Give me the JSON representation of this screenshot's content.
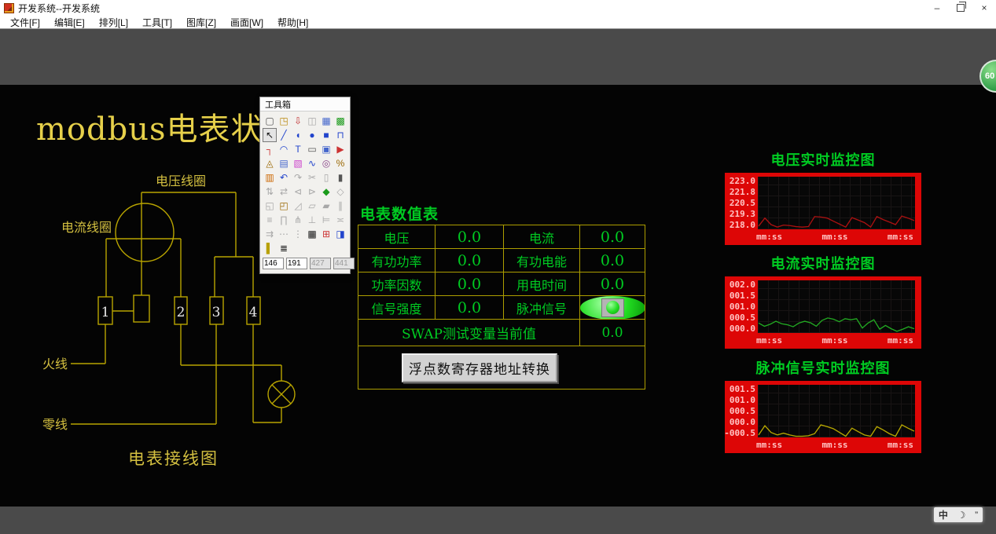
{
  "window": {
    "title": "开发系统--开发系统",
    "minimize": "–",
    "close": "×"
  },
  "menu": {
    "items": [
      {
        "id": "file",
        "label": "文件[F]"
      },
      {
        "id": "edit",
        "label": "编辑[E]"
      },
      {
        "id": "arrange",
        "label": "排列[L]"
      },
      {
        "id": "tools",
        "label": "工具[T]"
      },
      {
        "id": "gallery",
        "label": "图库[Z]"
      },
      {
        "id": "screen",
        "label": "画面[W]"
      },
      {
        "id": "help",
        "label": "帮助[H]"
      }
    ]
  },
  "page": {
    "title": "modbus电表状态"
  },
  "toolbox": {
    "title": "工具箱",
    "icons": [
      {
        "n": "new-file",
        "g": "▢",
        "c": "#555",
        "e": 1
      },
      {
        "n": "open-file",
        "g": "◳",
        "c": "#b8860b",
        "e": 1
      },
      {
        "n": "import",
        "g": "⇩",
        "c": "#c03030",
        "e": 1
      },
      {
        "n": "save",
        "g": "◫",
        "c": "#999",
        "e": 0
      },
      {
        "n": "preview",
        "g": "▦",
        "c": "#4466cc",
        "e": 1
      },
      {
        "n": "run",
        "g": "▩",
        "c": "#1a9a1a",
        "e": 1
      },
      {
        "n": "select",
        "g": "↖",
        "c": "#111",
        "e": 1,
        "a": 1
      },
      {
        "n": "line-tool",
        "g": "╱",
        "c": "#2244cc",
        "e": 1
      },
      {
        "n": "ellipse-tool",
        "g": "◖",
        "c": "#2244cc",
        "e": 1
      },
      {
        "n": "circle-tool",
        "g": "●",
        "c": "#2244cc",
        "e": 1
      },
      {
        "n": "rectangle-tool",
        "g": "■",
        "c": "#2244cc",
        "e": 1
      },
      {
        "n": "polyline-tool",
        "g": "⊓",
        "c": "#2244cc",
        "e": 1
      },
      {
        "n": "pipe-tool",
        "g": "┐",
        "c": "#cc3333",
        "e": 1
      },
      {
        "n": "arc-tool",
        "g": "◠",
        "c": "#2244cc",
        "e": 1
      },
      {
        "n": "text-tool",
        "g": "T",
        "c": "#2244cc",
        "e": 1
      },
      {
        "n": "rounded-rect-tool",
        "g": "▭",
        "c": "#555",
        "e": 1
      },
      {
        "n": "bitmap-tool",
        "g": "▣",
        "c": "#4466cc",
        "e": 1
      },
      {
        "n": "animation-tool",
        "g": "▶",
        "c": "#cc3333",
        "e": 1
      },
      {
        "n": "alarm-tool",
        "g": "◬",
        "c": "#996600",
        "e": 1
      },
      {
        "n": "report-tool",
        "g": "▤",
        "c": "#4466cc",
        "e": 1
      },
      {
        "n": "gif-tool",
        "g": "▧",
        "c": "#cc44cc",
        "e": 1
      },
      {
        "n": "trend-tool",
        "g": "∿",
        "c": "#2244cc",
        "e": 1
      },
      {
        "n": "ole-tool",
        "g": "◎",
        "c": "#884488",
        "e": 1
      },
      {
        "n": "scale-tool",
        "g": "%",
        "c": "#996600",
        "e": 1
      },
      {
        "n": "multi-state",
        "g": "▥",
        "c": "#cc6600",
        "e": 1
      },
      {
        "n": "undo",
        "g": "↶",
        "c": "#2244cc",
        "e": 1
      },
      {
        "n": "redo",
        "g": "↷",
        "c": "#999",
        "e": 0
      },
      {
        "n": "cut",
        "g": "✂",
        "c": "#999",
        "e": 0
      },
      {
        "n": "copy",
        "g": "▯",
        "c": "#999",
        "e": 0
      },
      {
        "n": "paste",
        "g": "▮",
        "c": "#555",
        "e": 1
      },
      {
        "n": "flip-vertical",
        "g": "⇅",
        "c": "#999",
        "e": 0
      },
      {
        "n": "flip-horizontal",
        "g": "⇄",
        "c": "#999",
        "e": 0
      },
      {
        "n": "rotate-left",
        "g": "⊲",
        "c": "#999",
        "e": 0
      },
      {
        "n": "rotate-right",
        "g": "⊳",
        "c": "#999",
        "e": 0
      },
      {
        "n": "group",
        "g": "◆",
        "c": "#1a9a1a",
        "e": 1
      },
      {
        "n": "ungroup",
        "g": "◇",
        "c": "#999",
        "e": 0
      },
      {
        "n": "bring-front",
        "g": "◱",
        "c": "#999",
        "e": 0
      },
      {
        "n": "send-back",
        "g": "◰",
        "c": "#996600",
        "e": 1
      },
      {
        "n": "skew",
        "g": "◿",
        "c": "#999",
        "e": 0
      },
      {
        "n": "node-edit",
        "g": "▱",
        "c": "#999",
        "e": 0
      },
      {
        "n": "copy-style",
        "g": "▰",
        "c": "#999",
        "e": 0
      },
      {
        "n": "same-size",
        "g": "∥",
        "c": "#999",
        "e": 0
      },
      {
        "n": "align-left",
        "g": "≡",
        "c": "#999",
        "e": 0
      },
      {
        "n": "align-top",
        "g": "∏",
        "c": "#999",
        "e": 0
      },
      {
        "n": "align-center",
        "g": "⋔",
        "c": "#999",
        "e": 0
      },
      {
        "n": "align-bottom",
        "g": "⊥",
        "c": "#999",
        "e": 0
      },
      {
        "n": "align-right",
        "g": "⊨",
        "c": "#999",
        "e": 0
      },
      {
        "n": "align-middle",
        "g": "≍",
        "c": "#999",
        "e": 0
      },
      {
        "n": "space-horizontal",
        "g": "⇉",
        "c": "#999",
        "e": 0
      },
      {
        "n": "space-dots",
        "g": "⋯",
        "c": "#999",
        "e": 0
      },
      {
        "n": "space-vertical",
        "g": "⋮",
        "c": "#999",
        "e": 0
      },
      {
        "n": "grid-toggle",
        "g": "▦",
        "c": "#111",
        "e": 1
      },
      {
        "n": "palette",
        "g": "⊞",
        "c": "#cc3333",
        "e": 1
      },
      {
        "n": "pick-color",
        "g": "◨",
        "c": "#2244cc",
        "e": 1
      },
      {
        "n": "fill-style",
        "g": "▌",
        "c": "#b8a000",
        "e": 1
      },
      {
        "n": "line-style",
        "g": "≣",
        "c": "#111",
        "e": 1
      }
    ],
    "fields": [
      {
        "value": "146",
        "enabled": true
      },
      {
        "value": "191",
        "enabled": true
      },
      {
        "value": "427",
        "enabled": false
      },
      {
        "value": "441",
        "enabled": false
      }
    ]
  },
  "diagram": {
    "voltage_coil": "电压线圈",
    "current_coil": "电流线圈",
    "live_wire": "火线",
    "neutral_wire": "零线",
    "caption": "电表接线图",
    "terminals": [
      "1",
      "2",
      "3",
      "4"
    ]
  },
  "meter_table": {
    "title": "电表数值表",
    "rows": [
      [
        {
          "n": "voltage-label",
          "t": "lab",
          "v": "电压"
        },
        {
          "n": "voltage-value",
          "t": "val",
          "v": "0.0"
        },
        {
          "n": "current-label",
          "t": "lab",
          "v": "电流"
        },
        {
          "n": "current-value",
          "t": "val",
          "v": "0.0"
        }
      ],
      [
        {
          "n": "active-power-label",
          "t": "lab",
          "v": "有功功率"
        },
        {
          "n": "active-power-value",
          "t": "val",
          "v": "0.0"
        },
        {
          "n": "active-energy-label",
          "t": "lab",
          "v": "有功电能"
        },
        {
          "n": "active-energy-value",
          "t": "val",
          "v": "0.0"
        }
      ],
      [
        {
          "n": "power-factor-label",
          "t": "lab",
          "v": "功率因数"
        },
        {
          "n": "power-factor-value",
          "t": "val",
          "v": "0.0"
        },
        {
          "n": "usage-time-label",
          "t": "lab",
          "v": "用电时间"
        },
        {
          "n": "usage-time-value",
          "t": "val",
          "v": "0.0"
        }
      ],
      [
        {
          "n": "signal-strength-label",
          "t": "lab",
          "v": "信号强度"
        },
        {
          "n": "signal-strength-value",
          "t": "val",
          "v": "0.0"
        },
        {
          "n": "pulse-signal-label",
          "t": "lab",
          "v": "脉冲信号"
        },
        {
          "n": "pulse-led",
          "t": "led",
          "v": ""
        }
      ]
    ],
    "swap_label": "SWAP测试变量当前值",
    "swap_value": "0.0",
    "button_label": "浮点数寄存器地址转换"
  },
  "chart_data": [
    {
      "type": "line",
      "title": "电压实时监控图",
      "ylim": [
        218.0,
        223.0
      ],
      "yticks": [
        "223.0",
        "221.8",
        "220.5",
        "219.3",
        "218.0"
      ],
      "xticks": [
        "mm:ss",
        "mm:ss",
        "mm:ss"
      ],
      "line_color": "#aa1111",
      "grid": true,
      "legend": false,
      "values": [
        218.2,
        219.0,
        218.35,
        218.1,
        218.3,
        218.25,
        218.15,
        218.1,
        218.15,
        219.15,
        219.1,
        219.0,
        218.7,
        218.4,
        218.1,
        219.05,
        218.8,
        218.55,
        218.1,
        219.15,
        218.85,
        218.6,
        218.35,
        219.2,
        219.0,
        218.75
      ]
    },
    {
      "type": "line",
      "title": "电流实时监控图",
      "ylim": [
        0.0,
        2.0
      ],
      "yticks": [
        "002.0",
        "001.5",
        "001.0",
        "000.5",
        "000.0"
      ],
      "xticks": [
        "mm:ss",
        "mm:ss",
        "mm:ss"
      ],
      "line_color": "#22aa22",
      "grid": true,
      "legend": false,
      "values": [
        0.35,
        0.22,
        0.3,
        0.42,
        0.32,
        0.28,
        0.2,
        0.35,
        0.42,
        0.36,
        0.22,
        0.45,
        0.55,
        0.5,
        0.4,
        0.52,
        0.48,
        0.52,
        0.15,
        0.35,
        0.48,
        0.1,
        0.25,
        0.12,
        0.02,
        0.1,
        0.2,
        0.12
      ]
    },
    {
      "type": "line",
      "title": "脉冲信号实时监控图",
      "ylim": [
        -0.5,
        1.5
      ],
      "yticks": [
        "001.5",
        "001.0",
        "000.5",
        "000.0",
        "-000.5"
      ],
      "xticks": [
        "mm:ss",
        "mm:ss",
        "mm:ss"
      ],
      "line_color": "#b8a800",
      "grid": true,
      "legend": false,
      "values": [
        -0.45,
        -0.08,
        -0.35,
        -0.45,
        -0.38,
        -0.45,
        -0.5,
        -0.5,
        -0.48,
        -0.4,
        -0.05,
        -0.12,
        -0.2,
        -0.35,
        -0.5,
        -0.18,
        -0.32,
        -0.45,
        -0.5,
        -0.12,
        -0.25,
        -0.4,
        -0.5,
        -0.05,
        -0.18,
        -0.3
      ]
    }
  ],
  "overlay": {
    "speed_ball": "60",
    "ime_lang": "中",
    "ime_shape": "☽",
    "ime_punct": "”"
  },
  "colors": {
    "canvas_line": "#b8a400",
    "text_green": "#00cc22",
    "table_border": "#ad9e00",
    "chart_panel": "#dd0606",
    "chart_label": "#ffc4c4",
    "led_green": "#22dd22"
  }
}
